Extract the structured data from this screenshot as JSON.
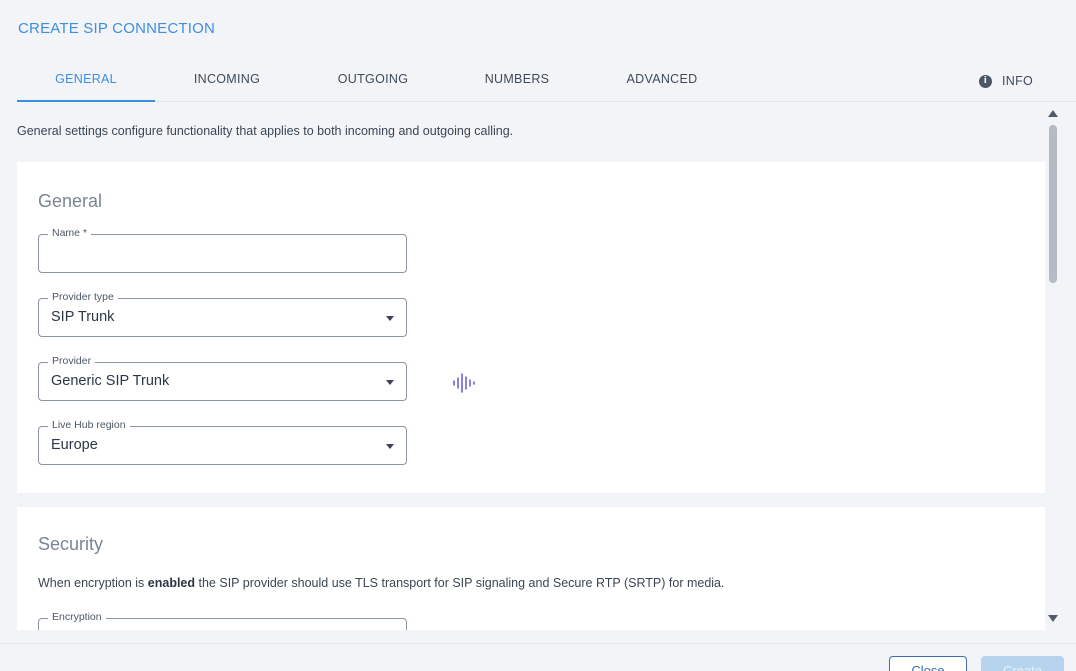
{
  "dialog": {
    "title": "CREATE SIP CONNECTION"
  },
  "tabs": [
    {
      "label": "GENERAL",
      "active": true
    },
    {
      "label": "INCOMING"
    },
    {
      "label": "OUTGOING"
    },
    {
      "label": "NUMBERS"
    },
    {
      "label": "ADVANCED"
    }
  ],
  "info_tab": {
    "label": "INFO",
    "icon": "info-icon"
  },
  "intro": "General settings configure functionality that applies to both incoming and outgoing calling.",
  "general": {
    "title": "General",
    "name": {
      "label": "Name *",
      "value": ""
    },
    "provider_type": {
      "label": "Provider type",
      "value": "SIP Trunk"
    },
    "provider": {
      "label": "Provider",
      "value": "Generic SIP Trunk",
      "icon": "audio-wave-icon"
    },
    "region": {
      "label": "Live Hub region",
      "value": "Europe"
    }
  },
  "security": {
    "title": "Security",
    "text_before": "When encryption is ",
    "text_bold": "enabled",
    "text_after": " the SIP provider should use TLS transport for SIP signaling and Secure RTP (SRTP) for media.",
    "encryption_label": "Encryption"
  },
  "footer": {
    "close_label": "Close",
    "create_label": "Create"
  },
  "colors": {
    "accent": "#3c8fe0",
    "icon_purple": "#6c63e0"
  }
}
